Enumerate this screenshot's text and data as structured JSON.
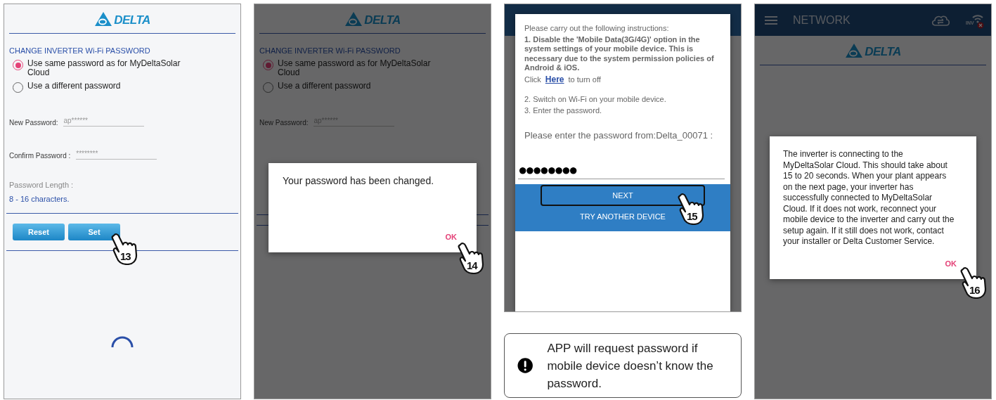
{
  "panels": [
    {
      "kind": "form",
      "logo": "DELTA",
      "heading": "CHANGE INVERTER Wi-Fi PASSWORD",
      "options": [
        {
          "label": "Use same password as for MyDeltaSolar Cloud",
          "selected": true
        },
        {
          "label": "Use a different password",
          "selected": false
        }
      ],
      "fields": [
        {
          "label": "New Password:",
          "placeholder": "ap******"
        },
        {
          "label": "Confirm Password :",
          "placeholder": "********"
        }
      ],
      "length_label": "Password Length :",
      "length_value": "8 - 16 characters.",
      "buttons": [
        "Reset",
        "Set"
      ],
      "loading": true,
      "step": "13"
    },
    {
      "kind": "form",
      "dimmed": true,
      "logo": "DELTA",
      "heading": "CHANGE INVERTER Wi-Fi PASSWORD",
      "options": [
        {
          "label": "Use same password as for MyDeltaSolar Cloud",
          "selected": true
        },
        {
          "label": "Use a different password",
          "selected": false
        }
      ],
      "fields": [
        {
          "label": "New Password:",
          "placeholder": "ap******"
        }
      ],
      "dialog": {
        "message": "Your password has been changed.",
        "action": "OK"
      },
      "step": "14"
    },
    {
      "kind": "password_prompt",
      "dimmed": true,
      "dialog": {
        "intro": "Please carry out the following instructions:",
        "warning": "1. Disable the 'Mobile Data(3G/4G)' option in the system settings of your mobile device. This is necessary due to the system permission policies of Android & iOS.",
        "click": "Click",
        "link": "Here",
        "after": "to turn off",
        "steps": [
          "2. Switch on Wi-Fi on your mobile device.",
          "3. Enter the password."
        ],
        "prompt": "Please enter the password from:Delta_00071 :",
        "value": "●●●●●●●●",
        "buttons": [
          {
            "label": "NEXT",
            "highlighted": true
          },
          {
            "label": "TRY ANOTHER DEVICE",
            "highlighted": false
          }
        ]
      },
      "step": "15",
      "note": "APP will request password if mobile device doesn’t know the password."
    },
    {
      "kind": "network",
      "dimmed": true,
      "title": "NETWORK",
      "badge": "INV",
      "logo": "DELTA",
      "dialog": {
        "message": "The inverter is connecting to the MyDeltaSolar Cloud. This should take about 15 to 20 seconds. When your plant appears on the next page, your inverter has successfully connected to MyDeltaSolar Cloud. If it does not work, reconnect your mobile device to the inverter and carry out the setup again. If it still does not work, contact your installer or Delta Customer Service.",
        "action": "OK"
      },
      "step": "16"
    }
  ]
}
